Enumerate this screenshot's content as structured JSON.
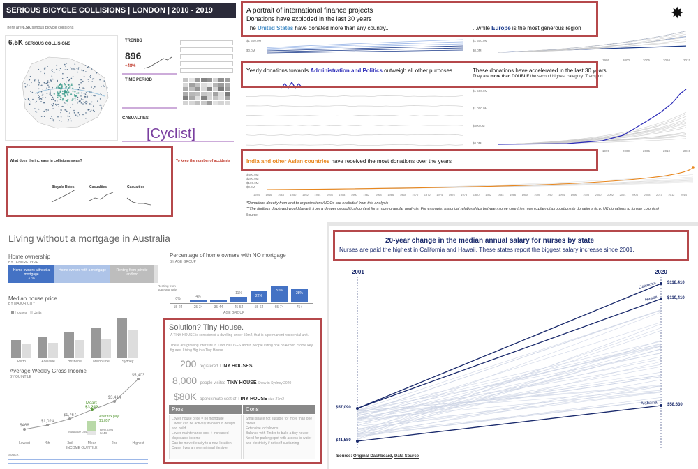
{
  "collisions": {
    "title": "SERIOUS BICYCLE COLLISIONS | LONDON | 2010 - 2019",
    "intro_pre": "There are ",
    "intro_count": "6,5K",
    "intro_post": " serious bicycle collisions",
    "map_label_count": "6,5K",
    "map_label_text": "SERIOUS COLLISIONS",
    "trends_heading": "TRENDS",
    "trends_value": "896",
    "trends_change": "+48%",
    "time_period_heading": "TIME PERIOD",
    "casualties_heading": "CASUALTIES",
    "casualties_word": "[Cyclist]",
    "bottom_heading": "What does the increase in collisions mean?",
    "bottom_labels": [
      "Bicycle Rides",
      "Casualties",
      "Casualties"
    ]
  },
  "finance": {
    "title": "A portrait of international finance projects",
    "subtitle": "Donations have exploded in the last 30 years",
    "us_pre": "The ",
    "us_name": "United States",
    "us_post": " have donated more than any country...",
    "eu_pre": "...while ",
    "eu_name": "Europe",
    "eu_post": " is the most generous region",
    "purpose_pre": "Yearly donations towards ",
    "purpose_name": "Administration and Politics",
    "purpose_post": " outweigh all other purposes",
    "accel_title": "These donations have accelerated in the last 30 years",
    "accel_sub_pre": "They are ",
    "accel_sub_bold": "more than DOUBLE",
    "accel_sub_post": " the second highest category: Transport",
    "india_name": "India and other Asian countries",
    "india_post": " have received the most donations over the years",
    "axis_top_left": [
      "$1 500.0M",
      "$0.0M"
    ],
    "axis_top_right": [
      "$1 500.0M",
      "$0.0M"
    ],
    "axis_mid_right": [
      "$1 500.0M",
      "$1 000.0M",
      "$500.0M",
      "$0.0M"
    ],
    "axis_bottom": [
      "$400.0M",
      "$200.0M",
      "$100.0M",
      "$0.0M"
    ],
    "years_top": [
      "1995",
      "2000",
      "2005",
      "2010",
      "2015"
    ],
    "years_mid": [
      "1995",
      "2000",
      "2005",
      "2010",
      "2015"
    ],
    "years_bottom": [
      "1944",
      "1946",
      "1948",
      "1950",
      "1952",
      "1954",
      "1956",
      "1958",
      "1960",
      "1962",
      "1964",
      "1966",
      "1968",
      "1970",
      "1972",
      "1974",
      "1976",
      "1978",
      "1980",
      "1982",
      "1984",
      "1986",
      "1988",
      "1990",
      "1992",
      "1994",
      "1996",
      "1998",
      "2000",
      "2002",
      "2004",
      "2006",
      "2008",
      "2010",
      "2012",
      "2014"
    ],
    "note1": "*Donations directly from and to organizations/NGOs are excluded from this analysis",
    "note2": "**The findings displayed would benefit from a deeper geopolitical context for a more granular analysis. For example, historical relationships between some countries may explain disproportions in donations (e.g. UK donations to former colonies)",
    "source": "Source:"
  },
  "mortgage": {
    "title": "Living without a mortgage in Australia",
    "ownership_heading": "Home ownership",
    "ownership_sub": "BY TENURE TYPE",
    "ownership_segments": [
      {
        "label": "Home owners without a mortgage",
        "value": "31%"
      },
      {
        "label": "Home owners with a mortgage",
        "value": ""
      },
      {
        "label": "Renting from private landlord",
        "value": ""
      }
    ],
    "ownership_extra": "Renting from state authority",
    "pct_heading": "Percentage of home owners with NO mortgage",
    "pct_sub": "BY AGE GROUP",
    "age_groups": [
      "15-24",
      "25-34",
      "35-44",
      "45-54",
      "55-64",
      "65-74",
      "75+"
    ],
    "age_values": [
      "0%",
      "4%",
      "",
      "11%",
      "22%",
      "33%",
      "28%"
    ],
    "age_axis": "AGE GROUP",
    "median_heading": "Median house price",
    "median_sub": "BY MAJOR CITY",
    "legend_houses": "Houses",
    "legend_units": "Units",
    "cities": [
      "Perth",
      "Adelaide",
      "Brisbane",
      "Melbourne",
      "Sydney"
    ],
    "income_heading": "Average Weekly Gross Income",
    "income_sub": "BY QUINTILE",
    "income_values": [
      "$468",
      "$1,024",
      "$1,767",
      "$3,242",
      "$3,414",
      "$5,403"
    ],
    "quintiles": [
      "Lowest",
      "4th",
      "3rd",
      "Mean",
      "2nd",
      "Highest"
    ],
    "quintile_axis": "INCOME QUINTILE",
    "mean_label": "Mean:",
    "mean_value": "$3,242",
    "after_tax_label": "After tax pay:",
    "after_tax_value": "$1,857",
    "mortgage_cost_label": "Mortgage cost",
    "rent_cost_label": "Rent cost",
    "rent_cost_value": "$448",
    "solution_title": "Solution? Tiny House.",
    "solution_text": "A TINY HOUSE is considered a dwelling under 50m2, that is a permanent residential unit.",
    "solution_text2": "There are growing interests in TINY HOUSES and in people listing one on Airbnb. Some key figures: Living Big in a Tiny House",
    "stats": [
      {
        "value": "200",
        "pre": "registered ",
        "bold": "TINY HOUSES"
      },
      {
        "value": "8,000",
        "pre": "people visited ",
        "bold": "TINY HOUSE",
        "post": " Show in Sydney 2020"
      },
      {
        "value": "$80K",
        "pre": "approximate cost of ",
        "bold": "TINY HOUSE",
        "post": " size 27m2"
      }
    ],
    "pros_heading": "Pros",
    "cons_heading": "Cons",
    "pros": [
      "Lower house price = no mortgage",
      "Owner can be actively involved in design and build",
      "Lower maintenance cost + increased disposable income",
      "Can be moved easily to a new location",
      "Owner lives a more minimal lifestyle"
    ],
    "cons": [
      "Small space not suitable for more than one owner",
      "Extensive lockdowns",
      "Balance with Tinder to build a tiny house",
      "Need for parking spot with access to water and electricity if not self-sustaining"
    ],
    "footer_label": "Source:"
  },
  "nurses": {
    "title": "20-year change in the median annual salary for nurses by state",
    "subtitle": "Nurses are paid the highest in California and Hawaii. These states report the biggest salary increase since 2001.",
    "year_start": "2001",
    "year_end": "2020",
    "left_values": [
      "$57,090",
      "$41,580"
    ],
    "right_values": [
      "$118,410",
      "$110,410",
      "$58,630"
    ],
    "state_labels": [
      "California",
      "Hawaii",
      "Alabama"
    ],
    "source_label": "Source: ",
    "source_link1": "Original Dashboard",
    "source_sep": ", ",
    "source_link2": "Data Source"
  },
  "colors": {
    "red_box": "#b5484b",
    "navy": "#1a2a6c",
    "blue_bar": "#4472c4",
    "orange": "#e8871e",
    "purple": "#7a3fa0"
  }
}
